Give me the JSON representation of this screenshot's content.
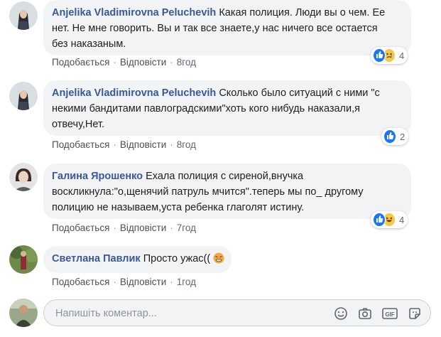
{
  "comments": [
    {
      "author": "Anjelika Vladimirovna Peluchevih",
      "text": "Какая полиция. Люди вы о чем. Ее нет. Не мне говорить. Вы и так все знаете,у нас ничего все остается без наказаным.",
      "like_label": "Подобається",
      "reply_label": "Відповісти",
      "time": "8год",
      "reactions": [
        "like",
        "sad"
      ],
      "reaction_count": "4"
    },
    {
      "author": "Anjelika Vladimirovna Peluchevih",
      "text": "Сколько было ситуаций с ними \"с некими бандитами павлоградскими\"хоть кого нибудь наказали,я отвечу,Нет.",
      "like_label": "Подобається",
      "reply_label": "Відповісти",
      "time": "8год",
      "reactions": [
        "like"
      ],
      "reaction_count": "2"
    },
    {
      "author": "Галина Ярошенко",
      "text": "Ехала полиция с сиреной,внучка воскликнула:\"о,щенячий патруль мчится\".теперь мы по_ другому полицию не называем,уста ребенка глаголят истину.",
      "like_label": "Подобається",
      "reply_label": "Відповісти",
      "time": "7год",
      "reactions": [
        "like",
        "haha"
      ],
      "reaction_count": "4"
    },
    {
      "author": "Светлана Павлик",
      "text": "Просто ужас((",
      "like_label": "Подобається",
      "reply_label": "Відповісти",
      "time": "1год",
      "reactions": [],
      "reaction_count": ""
    }
  ],
  "composer": {
    "placeholder": "Напишіть коментар...",
    "icons": [
      "emoji-icon",
      "camera-icon",
      "gif-icon",
      "sticker-icon"
    ]
  },
  "colors": {
    "author": "#385898",
    "bubble": "#f2f3f5",
    "like_blue": "#1877f2",
    "emoji_yellow": "#f7c844"
  }
}
